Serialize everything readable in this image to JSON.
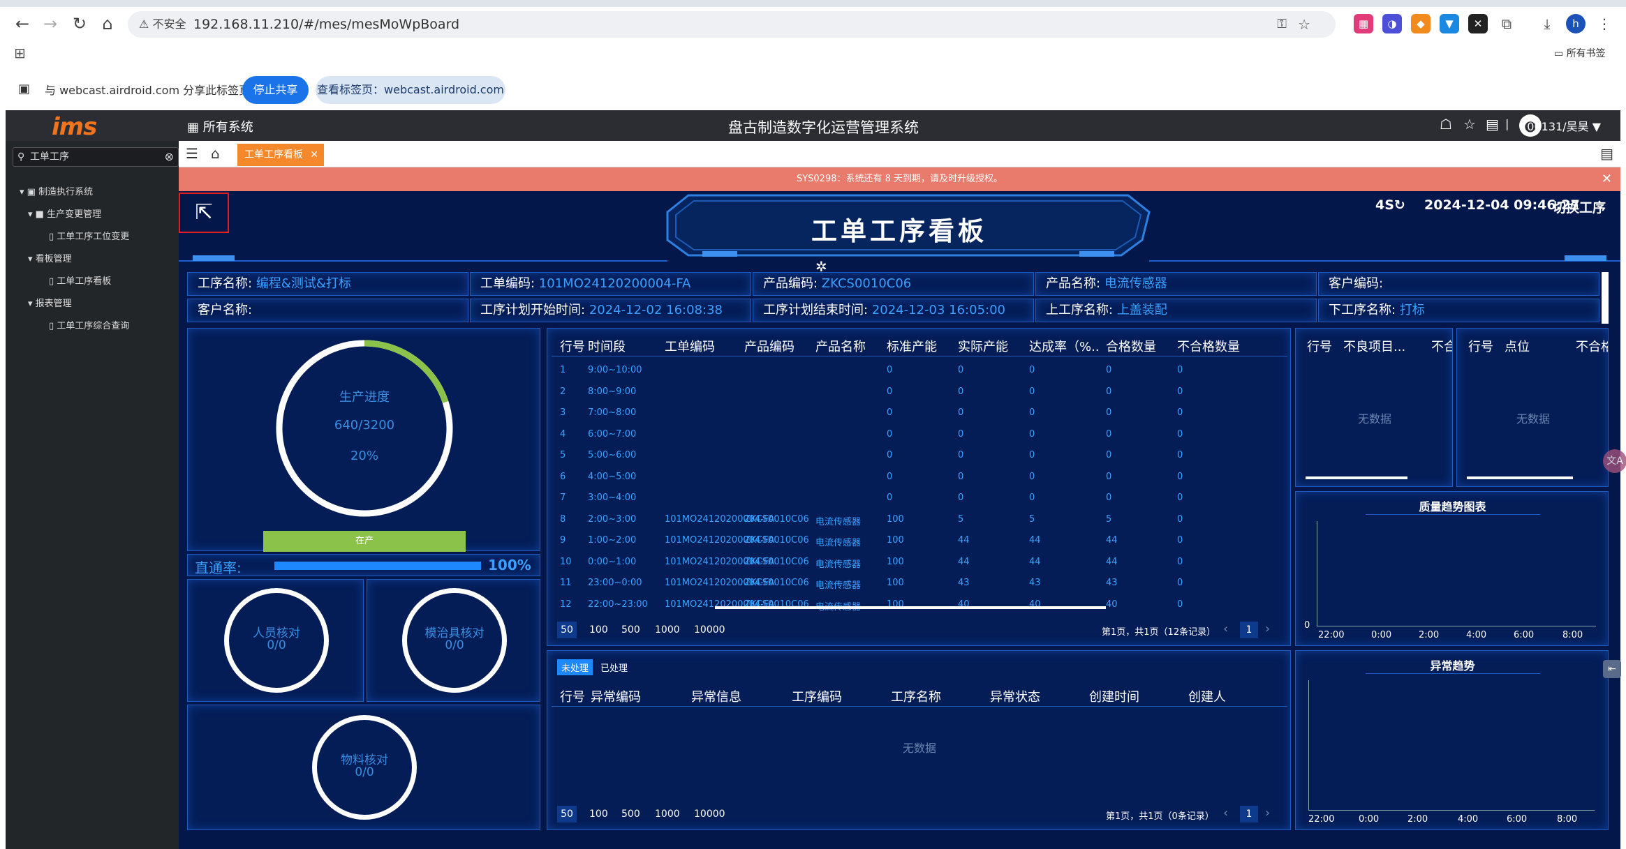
{
  "browser": {
    "url": "192.168.11.210/#/mes/mesMoWpBoard",
    "insecure_label": "不安全",
    "bookmarks_label": "所有书签",
    "share_text": "与 webcast.airdroid.com 分享此标签页",
    "stop_share": "停止共享",
    "view_tab": "查看标签页：webcast.airdroid.com",
    "avatar_letter": "h"
  },
  "app": {
    "logo": "ims",
    "all_systems": "所有系统",
    "system_title": "盘古制造数字化运营管理系统",
    "user": "00131/吴昊"
  },
  "sidebar": {
    "search_value": "工单工序",
    "tree": [
      "制造执行系统",
      "生产变更管理",
      "工单工序工位变更",
      "看板管理",
      "工单工序看板",
      "报表管理",
      "工单工序综合查询"
    ]
  },
  "tabs": {
    "active": "工单工序看板"
  },
  "notice": "SYS0298：系统还有 8 天到期，请及时升级授权。",
  "dashboard": {
    "title": "工单工序看板",
    "refresh": "4S",
    "datetime": "2024-12-04 09:46:27",
    "switch": "切换工序",
    "info": {
      "proc_name_label": "工序名称:",
      "proc_name": "编程&测试&打标",
      "wo_code_label": "工单编码:",
      "wo_code": "101MO24120200004-FA",
      "prod_code_label": "产品编码:",
      "prod_code": "ZKCS0010C06",
      "prod_name_label": "产品名称:",
      "prod_name": "电流传感器",
      "cust_code_label": "客户编码:",
      "cust_code": "",
      "cust_name_label": "客户名称:",
      "cust_name": "",
      "plan_start_label": "工序计划开始时间:",
      "plan_start": "2024-12-02 16:08:38",
      "plan_end_label": "工序计划结束时间:",
      "plan_end": "2024-12-03 16:05:00",
      "prev_proc_label": "上工序名称:",
      "prev_proc": "上盖装配",
      "next_proc_label": "下工序名称:",
      "next_proc": "打标"
    },
    "progress": {
      "label": "生产进度",
      "count": "640/3200",
      "percent": "20%",
      "fraction": 0.2,
      "status": "在产"
    },
    "pass_rate": {
      "label": "直通率:",
      "value": "100%",
      "fraction": 1.0
    },
    "checks": [
      {
        "label": "人员核对",
        "value": "0/0"
      },
      {
        "label": "模治具核对",
        "value": "0/0"
      },
      {
        "label": "物料核对",
        "value": "0/0"
      }
    ],
    "hourly_table": {
      "headers": [
        "行号",
        "时间段",
        "工单编码",
        "产品编码",
        "产品名称",
        "标准产能",
        "实际产能",
        "达成率（%...",
        "合格数量",
        "不合格数量"
      ],
      "rows": [
        [
          "1",
          "9:00~10:00",
          "",
          "",
          "",
          "0",
          "0",
          "0",
          "0",
          "0"
        ],
        [
          "2",
          "8:00~9:00",
          "",
          "",
          "",
          "0",
          "0",
          "0",
          "0",
          "0"
        ],
        [
          "3",
          "7:00~8:00",
          "",
          "",
          "",
          "0",
          "0",
          "0",
          "0",
          "0"
        ],
        [
          "4",
          "6:00~7:00",
          "",
          "",
          "",
          "0",
          "0",
          "0",
          "0",
          "0"
        ],
        [
          "5",
          "5:00~6:00",
          "",
          "",
          "",
          "0",
          "0",
          "0",
          "0",
          "0"
        ],
        [
          "6",
          "4:00~5:00",
          "",
          "",
          "",
          "0",
          "0",
          "0",
          "0",
          "0"
        ],
        [
          "7",
          "3:00~4:00",
          "",
          "",
          "",
          "0",
          "0",
          "0",
          "0",
          "0"
        ],
        [
          "8",
          "2:00~3:00",
          "101MO24120200004-FA",
          "ZKCS0010C06",
          "电流传感器",
          "100",
          "5",
          "5",
          "5",
          "0"
        ],
        [
          "9",
          "1:00~2:00",
          "101MO24120200004-FA",
          "ZKCS0010C06",
          "电流传感器",
          "100",
          "44",
          "44",
          "44",
          "0"
        ],
        [
          "10",
          "0:00~1:00",
          "101MO24120200004-FA",
          "ZKCS0010C06",
          "电流传感器",
          "100",
          "44",
          "44",
          "44",
          "0"
        ],
        [
          "11",
          "23:00~0:00",
          "101MO24120200004-FA",
          "ZKCS0010C06",
          "电流传感器",
          "100",
          "43",
          "43",
          "43",
          "0"
        ],
        [
          "12",
          "22:00~23:00",
          "101MO24120200004-FA",
          "ZKCS0010C06",
          "电流传感器",
          "100",
          "40",
          "40",
          "40",
          "0"
        ]
      ],
      "page_sizes": [
        "50",
        "100",
        "500",
        "1000",
        "10000"
      ],
      "page_info": "第1页，共1页（12条记录）",
      "page": "1"
    },
    "defect_table": {
      "headers": [
        "行号",
        "不良项目...",
        "不合"
      ],
      "empty": "无数据"
    },
    "point_table": {
      "headers": [
        "行号",
        "点位",
        "不合格"
      ],
      "empty": "无数据"
    },
    "quality_chart": {
      "title": "质量趋势图表",
      "zero": "0",
      "x": [
        "22:00",
        "0:00",
        "2:00",
        "4:00",
        "6:00",
        "8:00"
      ]
    },
    "exception_table": {
      "tabs": [
        "未处理",
        "已处理"
      ],
      "headers": [
        "行号",
        "异常编码",
        "异常信息",
        "工序编码",
        "工序名称",
        "异常状态",
        "创建时间",
        "创建人"
      ],
      "empty": "无数据",
      "page_sizes": [
        "50",
        "100",
        "500",
        "1000",
        "10000"
      ],
      "page_info": "第1页，共1页（0条记录）",
      "page": "1"
    },
    "exception_chart": {
      "title": "异常趋势",
      "x": [
        "22:00",
        "0:00",
        "2:00",
        "4:00",
        "6:00",
        "8:00"
      ]
    }
  }
}
